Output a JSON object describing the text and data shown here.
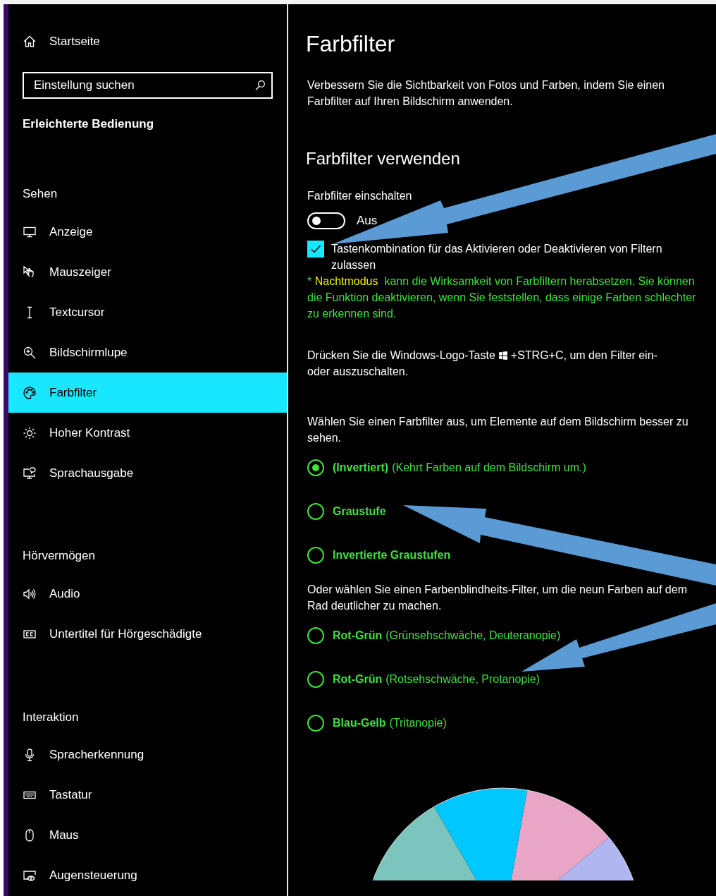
{
  "sidebar": {
    "home": "Startseite",
    "search": {
      "placeholder": "Einstellung suchen"
    },
    "title": "Erleichterte Bedienung",
    "groups": [
      {
        "heading": "Sehen",
        "items": [
          {
            "label": "Anzeige",
            "selected": false
          },
          {
            "label": "Mauszeiger",
            "selected": false
          },
          {
            "label": "Textcursor",
            "selected": false
          },
          {
            "label": "Bildschirmlupe",
            "selected": false
          },
          {
            "label": "Farbfilter",
            "selected": true
          },
          {
            "label": "Hoher Kontrast",
            "selected": false
          },
          {
            "label": "Sprachausgabe",
            "selected": false
          }
        ]
      },
      {
        "heading": "Hörvermögen",
        "items": [
          {
            "label": "Audio",
            "selected": false
          },
          {
            "label": "Untertitel für Hörgeschädigte",
            "selected": false
          }
        ]
      },
      {
        "heading": "Interaktion",
        "items": [
          {
            "label": "Spracherkennung",
            "selected": false
          },
          {
            "label": "Tastatur",
            "selected": false
          },
          {
            "label": "Maus",
            "selected": false
          },
          {
            "label": "Augensteuerung",
            "selected": false
          }
        ]
      }
    ]
  },
  "content": {
    "title": "Farbfilter",
    "intro": "Verbessern Sie die Sichtbarkeit von Fotos und Farben, indem Sie einen Farbfilter auf Ihren Bildschirm anwenden.",
    "section_title": "Farbfilter verwenden",
    "toggle": {
      "label": "Farbfilter einschalten",
      "on": false,
      "state_text": "Aus"
    },
    "checkbox": {
      "label": "Tastenkombination für das Aktivieren oder Deaktivieren von Filtern zulassen",
      "checked": true
    },
    "note": {
      "marker": "*",
      "highlight": "Nachtmodus",
      "text": "kann die Wirksamkeit von Farbfiltern herabsetzen. Sie können die Funktion deaktivieren, wenn Sie feststellen, dass einige Farben schlechter zu erkennen sind."
    },
    "shortcut": {
      "before": "Drücken Sie die Windows-Logo-Taste",
      "after": "+STRG+C, um den Filter ein-",
      "continuation": "oder auszuschalten."
    },
    "filters_intro": "Wählen Sie einen Farbfilter aus, um Elemente auf dem Bildschirm besser zu sehen.",
    "filters": [
      {
        "name": "(Invertiert)",
        "description": "(Kehrt Farben auf dem Bildschirm um.)",
        "selected": true
      },
      {
        "name": "Graustufe",
        "selected": false
      },
      {
        "name": "Invertierte Graustufen",
        "selected": false
      }
    ],
    "colorblind_intro": "Oder wählen Sie einen Farbenblindheits-Filter, um die neun Farben auf dem Rad deutlicher zu machen.",
    "colorblind_filters": [
      {
        "name": "Rot-Grün",
        "description": "(Grünsehschwäche, Deuteranopie)",
        "selected": false
      },
      {
        "name": "Rot-Grün",
        "description": "(Rotsehschwäche, Protanopie)",
        "selected": false
      },
      {
        "name": "Blau-Gelb",
        "description": "(Tritanopie)",
        "selected": false
      }
    ]
  }
}
